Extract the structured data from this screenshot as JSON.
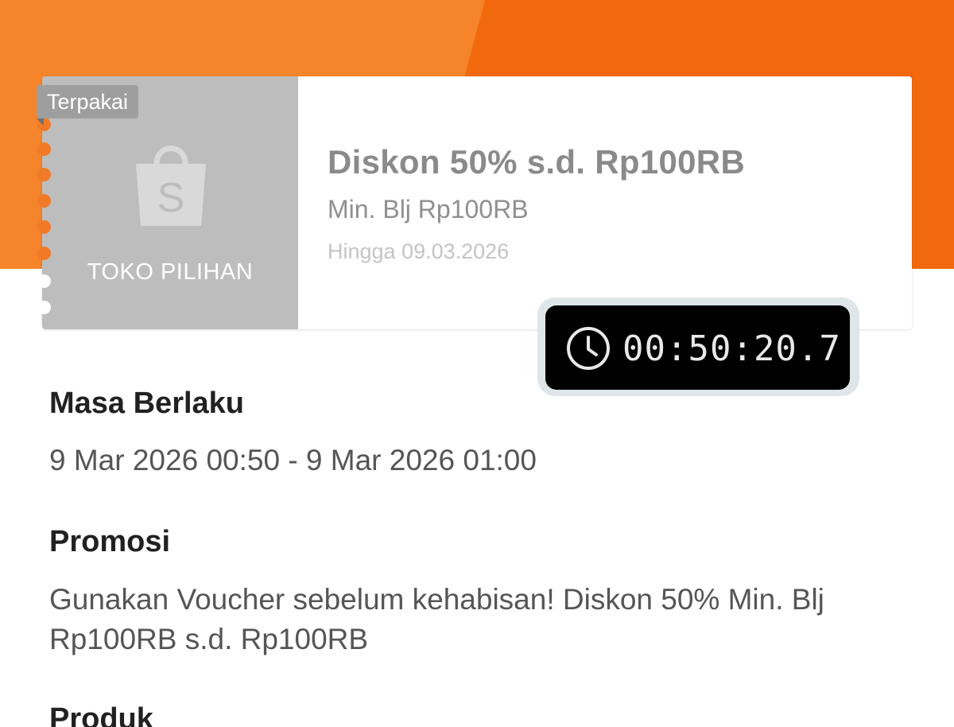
{
  "colors": {
    "header_primary": "#ee4d2d",
    "header_secondary": "#f5842a",
    "voucher_used_gray": "#bdbdbd",
    "timer_background": "#000000"
  },
  "voucher": {
    "status_badge": "Terpakai",
    "shop_label": "TOKO PILIHAN",
    "shop_icon": "shopping-bag-icon",
    "title": "Diskon 50% s.d. Rp100RB",
    "min_spend": "Min. Blj Rp100RB",
    "expiry": "Hingga 09.03.2026"
  },
  "timer": {
    "icon": "clock-icon",
    "value": "00:50:20.7"
  },
  "sections": {
    "validity": {
      "title": "Masa Berlaku",
      "body": "9 Mar 2026 00:50 - 9 Mar 2026 01:00"
    },
    "promotion": {
      "title": "Promosi",
      "body": "Gunakan Voucher sebelum kehabisan! Diskon 50% Min. Blj Rp100RB s.d. Rp100RB"
    },
    "product": {
      "title": "Produk"
    }
  }
}
